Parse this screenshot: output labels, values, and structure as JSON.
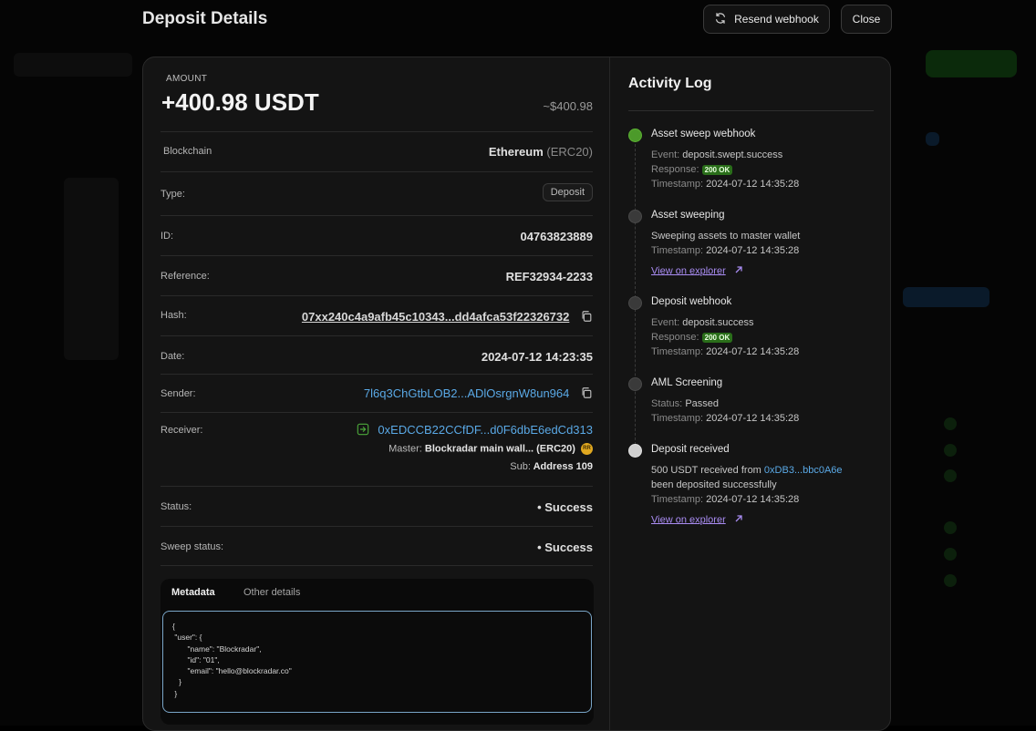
{
  "header": {
    "title": "Deposit Details",
    "resend_label": "Resend webhook",
    "close_label": "Close"
  },
  "amount": {
    "label": "AMOUNT",
    "value": "+400.98 USDT",
    "usd": "~$400.98"
  },
  "details": {
    "blockchain_label": "Blockchain",
    "blockchain_name": "Ethereum",
    "blockchain_std": "(ERC20)",
    "type_label": "Type:",
    "type_value": "Deposit",
    "id_label": "ID:",
    "id_value": "04763823889",
    "reference_label": "Reference:",
    "reference_value": "REF32934-2233",
    "hash_label": "Hash:",
    "hash_value": "07xx240c4a9afb45c10343...dd4afca53f22326732",
    "date_label": "Date:",
    "date_value": "2024-07-12 14:23:35",
    "sender_label": "Sender:",
    "sender_value": "7l6q3ChGtbLOB2...ADlOsrgnW8un964",
    "receiver_label": "Receiver:",
    "receiver_value": "0xEDCCB22CCfDF...d0F6dbE6edCd313",
    "master_label": "Master:",
    "master_value": "Blockradar main wall... (ERC20)",
    "master_badge": "RR",
    "sub_label": "Sub:",
    "sub_value": "Address 109",
    "status_label": "Status:",
    "status_value": "• Success",
    "sweep_label": "Sweep status:",
    "sweep_value": "• Success"
  },
  "metadata": {
    "tab_active": "Metadata",
    "tab_other": "Other details",
    "code": "{\n \"user\": {\n       \"name\": \"Blockradar\",\n       \"id\": \"01\",\n       \"email\": \"hello@blockradar.co\"\n   }\n }"
  },
  "activity": {
    "title": "Activity Log",
    "events": [
      {
        "name": "Asset sweep webhook",
        "event_label": "Event:",
        "event_value": "deposit.swept.success",
        "response_label": "Response:",
        "response_value": "200 OK",
        "timestamp_label": "Timestamp:",
        "timestamp_value": "2024-07-12 14:35:28"
      },
      {
        "name": "Asset sweeping",
        "desc": "Sweeping assets to master wallet",
        "timestamp_label": "Timestamp:",
        "timestamp_value": "2024-07-12 14:35:28",
        "link": "View on explorer"
      },
      {
        "name": "Deposit webhook",
        "event_label": "Event:",
        "event_value": "deposit.success",
        "response_label": "Response:",
        "response_value": "200 OK",
        "timestamp_label": "Timestamp:",
        "timestamp_value": "2024-07-12 14:35:28"
      },
      {
        "name": "AML Screening",
        "status_label": "Status:",
        "status_value": "Passed",
        "timestamp_label": "Timestamp:",
        "timestamp_value": "2024-07-12 14:35:28"
      },
      {
        "name": "Deposit received",
        "desc_prefix": "500 USDT received from",
        "desc_addr": "0xDB3...bbc0A6e",
        "desc_suffix": "been deposited successfully",
        "timestamp_label": "Timestamp:",
        "timestamp_value": "2024-07-12 14:35:28",
        "link": "View on explorer"
      }
    ]
  },
  "colors": {
    "success": "#23c55e",
    "link_blue": "#5aa9e6",
    "explorer_purple": "#a98cf2",
    "ok_badge": "#2a6e1a"
  }
}
